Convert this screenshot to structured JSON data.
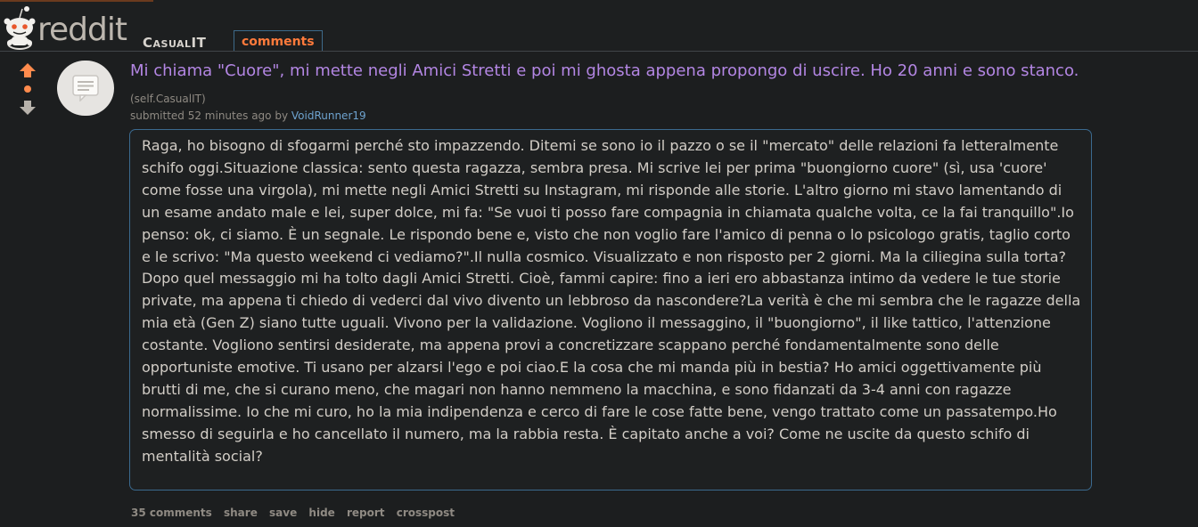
{
  "header": {
    "wordmark": "reddit",
    "subreddit": "CasualIT",
    "active_tab": "comments",
    "accent_color": "#ff7a3b"
  },
  "post": {
    "title": "Mi chiama \"Cuore\", mi mette negli Amici Stretti e poi mi ghosta appena propongo di uscire. Ho 20 anni e sono stanco.",
    "domain": "(self.CasualIT)",
    "submitted_prefix": "submitted 52 minutes ago by",
    "author": "VoidRunner19",
    "thumbnail_icon": "self-post-icon",
    "selftext": "Raga, ho bisogno di sfogarmi perché sto impazzendo. Ditemi se sono io il pazzo o se il \"mercato\" delle relazioni fa letteralmente schifo oggi.Situazione classica: sento questa ragazza, sembra presa. Mi scrive lei per prima \"buongiorno cuore\" (sì, usa 'cuore' come fosse una virgola), mi mette negli Amici Stretti su Instagram, mi risponde alle storie. L'altro giorno mi stavo lamentando di un esame andato male e lei, super dolce, mi fa: \"Se vuoi ti posso fare compagnia in chiamata qualche volta, ce la fai tranquillo\".Io penso: ok, ci siamo. È un segnale. Le rispondo bene e, visto che non voglio fare l'amico di penna o lo psicologo gratis, taglio corto e le scrivo: \"Ma questo weekend ci vediamo?\".Il nulla cosmico. Visualizzato e non risposto per 2 giorni. Ma la ciliegina sulla torta? Dopo quel messaggio mi ha tolto dagli Amici Stretti. Cioè, fammi capire: fino a ieri ero abbastanza intimo da vedere le tue storie private, ma appena ti chiedo di vederci dal vivo divento un lebbroso da nascondere?La verità è che mi sembra che le ragazze della mia età (Gen Z) siano tutte uguali. Vivono per la validazione. Vogliono il messaggino, il \"buongiorno\", il like tattico, l'attenzione costante. Vogliono sentirsi desiderate, ma appena provi a concretizzare scappano perché fondamentalmente sono delle opportuniste emotive. Ti usano per alzarsi l'ego e poi ciao.E la cosa che mi manda più in bestia? Ho amici oggettivamente più brutti di me, che si curano meno, che magari non hanno nemmeno la macchina, e sono fidanzati da 3-4 anni con ragazze normalissime. Io che mi curo, ho la mia indipendenza e cerco di fare le cose fatte bene, vengo trattato come un passatempo.Ho smesso di seguirla e ho cancellato il numero, ma la rabbia resta. È capitato anche a voi? Come ne uscite da questo schifo di mentalità social?",
    "buttons": {
      "comments": "35 comments",
      "share": "share",
      "save": "save",
      "hide": "hide",
      "report": "report",
      "crosspost": "crosspost"
    }
  },
  "colors": {
    "title": "#b386e3",
    "upvote": "#ff8b4d",
    "author": "#6ea3cf"
  }
}
